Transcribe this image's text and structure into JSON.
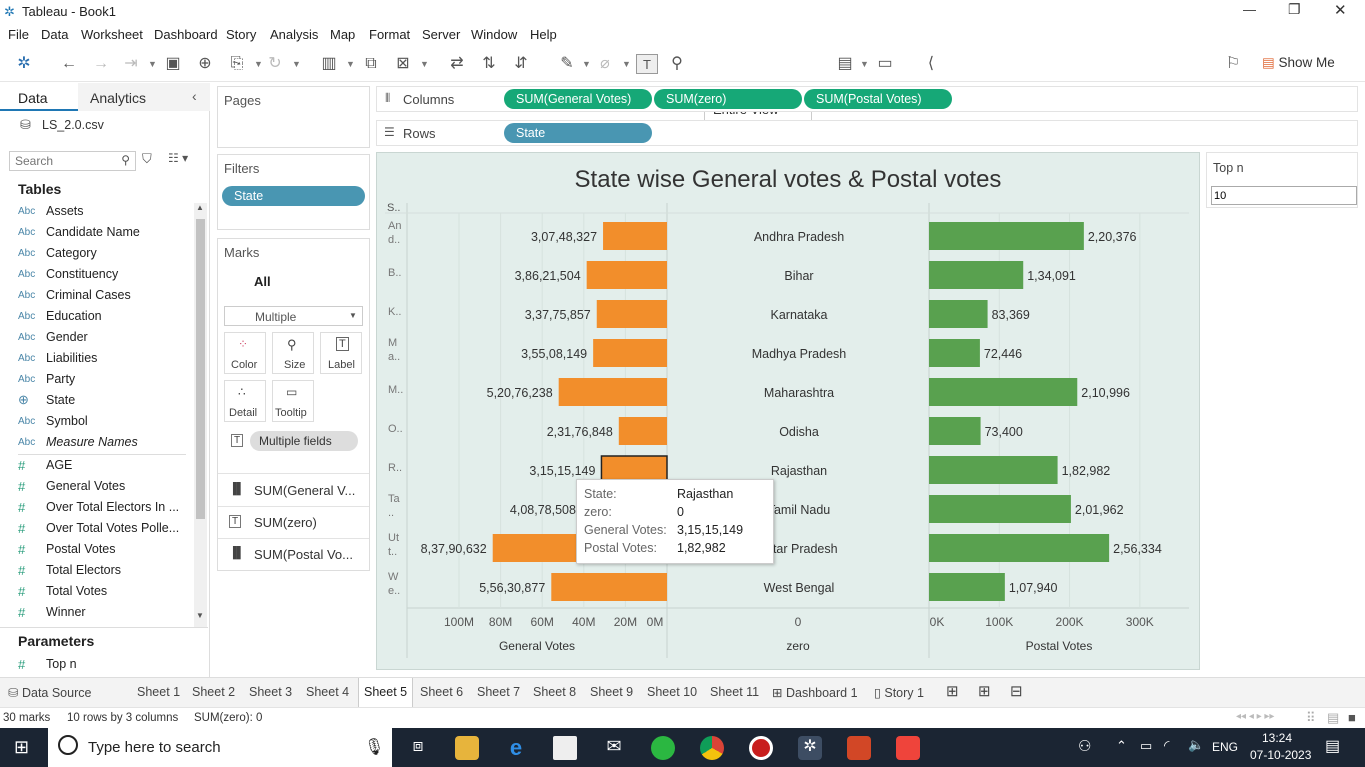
{
  "window": {
    "title": "Tableau - Book1",
    "controls": [
      "—",
      "❐",
      "✕"
    ]
  },
  "menu": [
    "File",
    "Data",
    "Worksheet",
    "Dashboard",
    "Story",
    "Analysis",
    "Map",
    "Format",
    "Server",
    "Window",
    "Help"
  ],
  "toolbar": {
    "view_select": "Entire View",
    "show_me": "Show Me"
  },
  "data_pane": {
    "tabs": [
      "Data",
      "Analytics"
    ],
    "source": "LS_2.0.csv",
    "search_placeholder": "Search",
    "tables_header": "Tables",
    "dimensions": [
      "Assets",
      "Candidate Name",
      "Category",
      "Constituency",
      "Criminal Cases",
      "Education",
      "Gender",
      "Liabilities",
      "Party",
      "State",
      "Symbol",
      "Measure Names"
    ],
    "measures": [
      "AGE",
      "General Votes",
      "Over Total Electors In ...",
      "Over Total Votes Polle...",
      "Postal Votes",
      "Total Electors",
      "Total Votes",
      "Winner"
    ],
    "parameters_header": "Parameters",
    "parameters": [
      "Top n"
    ],
    "abc": "Abc",
    "hash": "#"
  },
  "cards": {
    "pages": "Pages",
    "filters": "Filters",
    "filter_pill": "State",
    "marks": "Marks",
    "marks_all": "All",
    "mark_type": "Multiple",
    "mark_buttons": [
      "Color",
      "Size",
      "Label",
      "Detail",
      "Tooltip"
    ],
    "multiple_fields": "Multiple fields",
    "mark_rows": [
      "SUM(General V...",
      "SUM(zero)",
      "SUM(Postal Vo..."
    ]
  },
  "shelves": {
    "columns_label": "Columns",
    "rows_label": "Rows",
    "columns": [
      "SUM(General Votes)",
      "SUM(zero)",
      "SUM(Postal Votes)"
    ],
    "rows": [
      "State"
    ]
  },
  "parameter_card": {
    "title": "Top n",
    "value": "10"
  },
  "chart_data": {
    "type": "bar",
    "title": "State wise General votes & Postal votes",
    "row_header": "S..",
    "states_abbrev": [
      "An d..",
      "B..",
      "K..",
      "M a..",
      "M..",
      "O..",
      "R..",
      "Ta ..",
      "Ut t..",
      "W e.."
    ],
    "categories": [
      "Andhra Pradesh",
      "Bihar",
      "Karnataka",
      "Madhya Pradesh",
      "Maharashtra",
      "Odisha",
      "Rajasthan",
      "Tamil Nadu",
      "Uttar Pradesh",
      "West Bengal"
    ],
    "series": [
      {
        "name": "General Votes",
        "values": [
          30748327,
          38621504,
          33775857,
          35508149,
          52076238,
          23176848,
          31515149,
          40878508,
          83790632,
          55630877
        ],
        "labels": [
          "3,07,48,327",
          "3,86,21,504",
          "3,37,75,857",
          "3,55,08,149",
          "5,20,76,238",
          "2,31,76,848",
          "3,15,15,149",
          "4,08,78,508",
          "8,37,90,632",
          "5,56,30,877"
        ],
        "axis_ticks": [
          "100M",
          "80M",
          "60M",
          "40M",
          "20M",
          "0M"
        ],
        "axis_title": "General Votes",
        "xlim": [
          0,
          125000000
        ],
        "reversed": true,
        "color": "#f28e2b"
      },
      {
        "name": "zero",
        "values": [
          0,
          0,
          0,
          0,
          0,
          0,
          0,
          0,
          0,
          0
        ],
        "axis_ticks": [
          "0"
        ],
        "axis_title": "zero"
      },
      {
        "name": "Postal Votes",
        "values": [
          220376,
          134091,
          83369,
          72446,
          210996,
          73400,
          182982,
          201962,
          256334,
          107940
        ],
        "labels": [
          "2,20,376",
          "1,34,091",
          "83,369",
          "72,446",
          "2,10,996",
          "73,400",
          "1,82,982",
          "2,01,962",
          "2,56,334",
          "1,07,940"
        ],
        "axis_ticks": [
          "0K",
          "100K",
          "200K",
          "300K"
        ],
        "axis_title": "Postal Votes",
        "xlim": [
          0,
          370000
        ],
        "color": "#59a14f"
      }
    ]
  },
  "tooltip": {
    "rows": [
      [
        "State:",
        "Rajasthan"
      ],
      [
        "zero:",
        "0"
      ],
      [
        "General Votes:",
        "3,15,15,149"
      ],
      [
        "Postal Votes:",
        "1,82,982"
      ]
    ]
  },
  "sheet_tabs": {
    "data_source": "Data Source",
    "sheets": [
      "Sheet 1",
      "Sheet 2",
      "Sheet 3",
      "Sheet 4",
      "Sheet 5",
      "Sheet 6",
      "Sheet 7",
      "Sheet 8",
      "Sheet 9",
      "Sheet 10",
      "Sheet 11"
    ],
    "dashboard": "Dashboard 1",
    "story": "Story 1"
  },
  "status": {
    "marks": "30 marks",
    "rows_cols": "10 rows by 3 columns",
    "sum": "SUM(zero): 0"
  },
  "taskbar": {
    "search_placeholder": "Type here to search",
    "lang": "ENG",
    "time": "13:24",
    "date": "07-10-2023"
  }
}
